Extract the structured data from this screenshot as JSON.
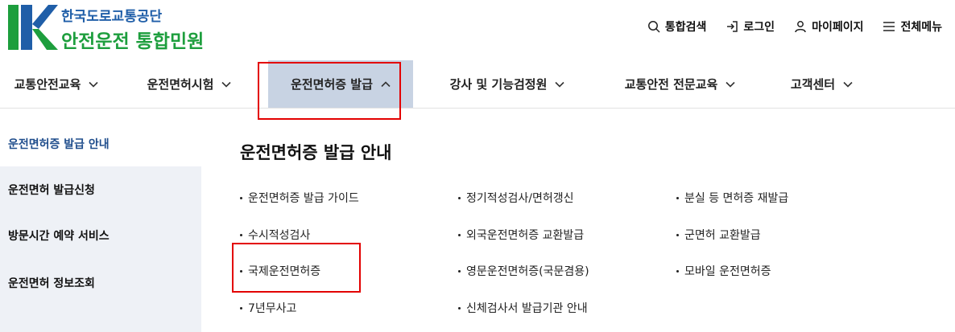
{
  "header": {
    "org_name": "한국도로교통공단",
    "service_name": "안전운전 통합민원",
    "utils": [
      {
        "label": "통합검색",
        "icon": "search-icon"
      },
      {
        "label": "로그인",
        "icon": "login-icon"
      },
      {
        "label": "마이페이지",
        "icon": "user-icon"
      },
      {
        "label": "전체메뉴",
        "icon": "hamburger-menu-icon"
      }
    ]
  },
  "gnb": {
    "items": [
      {
        "label": "교통안전교육",
        "icon": "chevron-down-icon"
      },
      {
        "label": "운전면허시험",
        "icon": "chevron-down-icon"
      },
      {
        "label": "운전면허증 발급",
        "icon": "chevron-up-icon",
        "active": true
      },
      {
        "label": "강사 및 기능검정원",
        "icon": "chevron-down-icon"
      },
      {
        "label": "교통안전 전문교육",
        "icon": "chevron-down-icon"
      },
      {
        "label": "고객센터",
        "icon": "chevron-down-icon"
      }
    ]
  },
  "lnb": {
    "items": [
      {
        "label": "운전면허증 발급 안내",
        "active": true
      },
      {
        "label": "운전면허 발급신청"
      },
      {
        "label": "방문시간 예약 서비스"
      },
      {
        "label": "운전면허 정보조회"
      }
    ]
  },
  "content": {
    "title": "운전면허증 발급 안내",
    "links": [
      [
        "운전면허증 발급 가이드",
        "정기적성검사/면허갱신",
        "분실 등 면허증 재발급"
      ],
      [
        "수시적성검사",
        "외국운전면허증 교환발급",
        "군면허 교환발급"
      ],
      [
        "국제운전면허증",
        "영문운전면허증(국문겸용)",
        "모바일 운전면허증"
      ],
      [
        "7년무사고",
        "신체검사서 발급기관 안내"
      ]
    ]
  },
  "colors": {
    "brand_blue": "#1f5ea8",
    "brand_green": "#1d9e3d",
    "active_tab_bg": "#c8d3e3",
    "lnb_bg": "#eef1f6",
    "highlight_red": "#e30000"
  }
}
